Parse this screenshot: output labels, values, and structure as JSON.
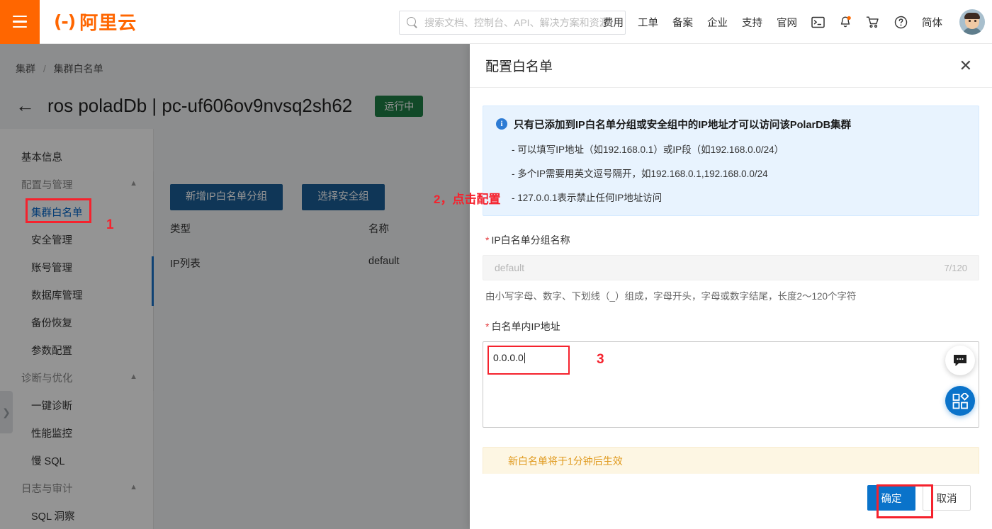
{
  "topbar": {
    "menu_icon": "hamburger-icon",
    "brand_mark": "(-)",
    "brand_text": "阿里云",
    "search_placeholder": "搜索文档、控制台、API、解决方案和资源",
    "search_value": "",
    "search_icon": "search-icon",
    "nav_links": [
      "费用",
      "工单",
      "备案",
      "企业",
      "支持",
      "官网"
    ],
    "icons": [
      "terminal-icon",
      "bell-icon",
      "cart-icon",
      "help-icon"
    ],
    "language": "简体",
    "avatar": "user-avatar"
  },
  "breadcrumb": {
    "root": "集群",
    "separator": "/",
    "current": "集群白名单"
  },
  "header": {
    "back_icon": "back-arrow-icon",
    "title": "ros poladDb | pc-uf606ov9nvsq2sh62",
    "status": "运行中",
    "status_color": "#1e7e45"
  },
  "sidebar": {
    "collapse_icon": "chevron-right-icon",
    "items": [
      {
        "label": "基本信息",
        "type": "item",
        "active": false
      },
      {
        "label": "配置与管理",
        "type": "group",
        "chevron": "chevron-up-icon"
      },
      {
        "label": "集群白名单",
        "type": "sub",
        "active": true
      },
      {
        "label": "安全管理",
        "type": "sub",
        "active": false
      },
      {
        "label": "账号管理",
        "type": "sub",
        "active": false
      },
      {
        "label": "数据库管理",
        "type": "sub",
        "active": false
      },
      {
        "label": "备份恢复",
        "type": "sub",
        "active": false
      },
      {
        "label": "参数配置",
        "type": "sub",
        "active": false
      },
      {
        "label": "诊断与优化",
        "type": "group",
        "chevron": "chevron-up-icon"
      },
      {
        "label": "一键诊断",
        "type": "sub",
        "active": false
      },
      {
        "label": "性能监控",
        "type": "sub",
        "active": false
      },
      {
        "label": "慢 SQL",
        "type": "sub",
        "active": false
      },
      {
        "label": "日志与审计",
        "type": "group",
        "chevron": "chevron-up-icon"
      },
      {
        "label": "SQL 洞察",
        "type": "sub",
        "active": false
      }
    ]
  },
  "main": {
    "buttons": [
      {
        "label": "新增IP白名单分组"
      },
      {
        "label": "选择安全组"
      }
    ],
    "table": {
      "columns": [
        "类型",
        "名称"
      ],
      "rows": [
        {
          "type": "IP列表",
          "name": "default"
        }
      ]
    }
  },
  "modal": {
    "title": "配置白名单",
    "close_icon": "close-icon",
    "info": {
      "icon": "info-icon",
      "heading": "只有已添加到IP白名单分组或安全组中的IP地址才可以访问该PolarDB集群",
      "lines": [
        "- 可以填写IP地址（如192.168.0.1）或IP段（如192.168.0.0/24）",
        "- 多个IP需要用英文逗号隔开，如192.168.0.1,192.168.0.0/24",
        "- 127.0.0.1表示禁止任何IP地址访问"
      ]
    },
    "group_name_field": {
      "required_mark": "*",
      "label": "IP白名单分组名称",
      "value": "default",
      "counter": "7/120",
      "hint": "由小写字母、数字、下划线（_）组成，字母开头，字母或数字结尾，长度2～120个字符"
    },
    "ip_field": {
      "required_mark": "*",
      "label": "白名单内IP地址",
      "value": "0.0.0.0",
      "placeholder": ""
    },
    "warning": "新白名单将于1分钟后生效",
    "confirm_label": "确定",
    "cancel_label": "取消"
  },
  "widgets": {
    "chat_icon": "chat-bubble-icon",
    "apps_icon": "apps-grid-icon"
  },
  "annotations": [
    {
      "id": "1",
      "text": "1"
    },
    {
      "id": "2",
      "text": "2，点击配置"
    },
    {
      "id": "3",
      "text": "3"
    }
  ],
  "colors": {
    "brand_orange": "#ff6600",
    "primary_blue": "#0a73ca",
    "button_blue": "#1b5e96",
    "annotation_red": "#f5222d",
    "status_green": "#1e7e45",
    "info_bg": "#e8f3fe",
    "warn_bg": "#fdf6e3"
  }
}
